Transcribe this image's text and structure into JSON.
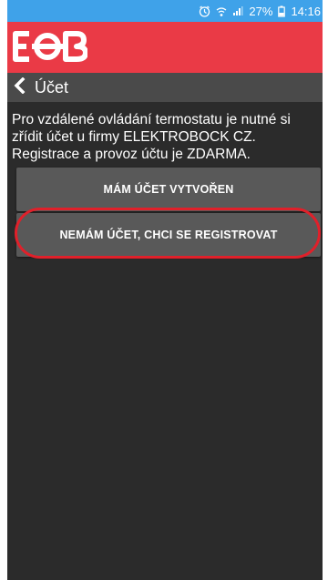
{
  "status": {
    "battery": "27%",
    "time": "14:16",
    "icons": [
      "alarm-icon",
      "wifi-icon",
      "signal-icon",
      "battery-icon"
    ]
  },
  "brand": {
    "logo_name": "EOB",
    "color": "#ea3a46"
  },
  "nav": {
    "title": "Účet",
    "back_icon": "chevron-left-icon"
  },
  "main": {
    "intro": "Pro vzdálené ovládání termostatu je nutné si zřídit účet u firmy ELEKTROBOCK CZ. Registrace a provoz účtu je ZDARMA.",
    "buttons": {
      "have_account": "MÁM ÚČET VYTVOŘEN",
      "register": "NEMÁM ÚČET, CHCI SE REGISTROVAT"
    }
  },
  "colors": {
    "status_bar": "#3fa2e9",
    "nav_bar": "#4a4a4a",
    "background": "#2b2b2b",
    "button": "#595959",
    "highlight": "#e0202a"
  }
}
